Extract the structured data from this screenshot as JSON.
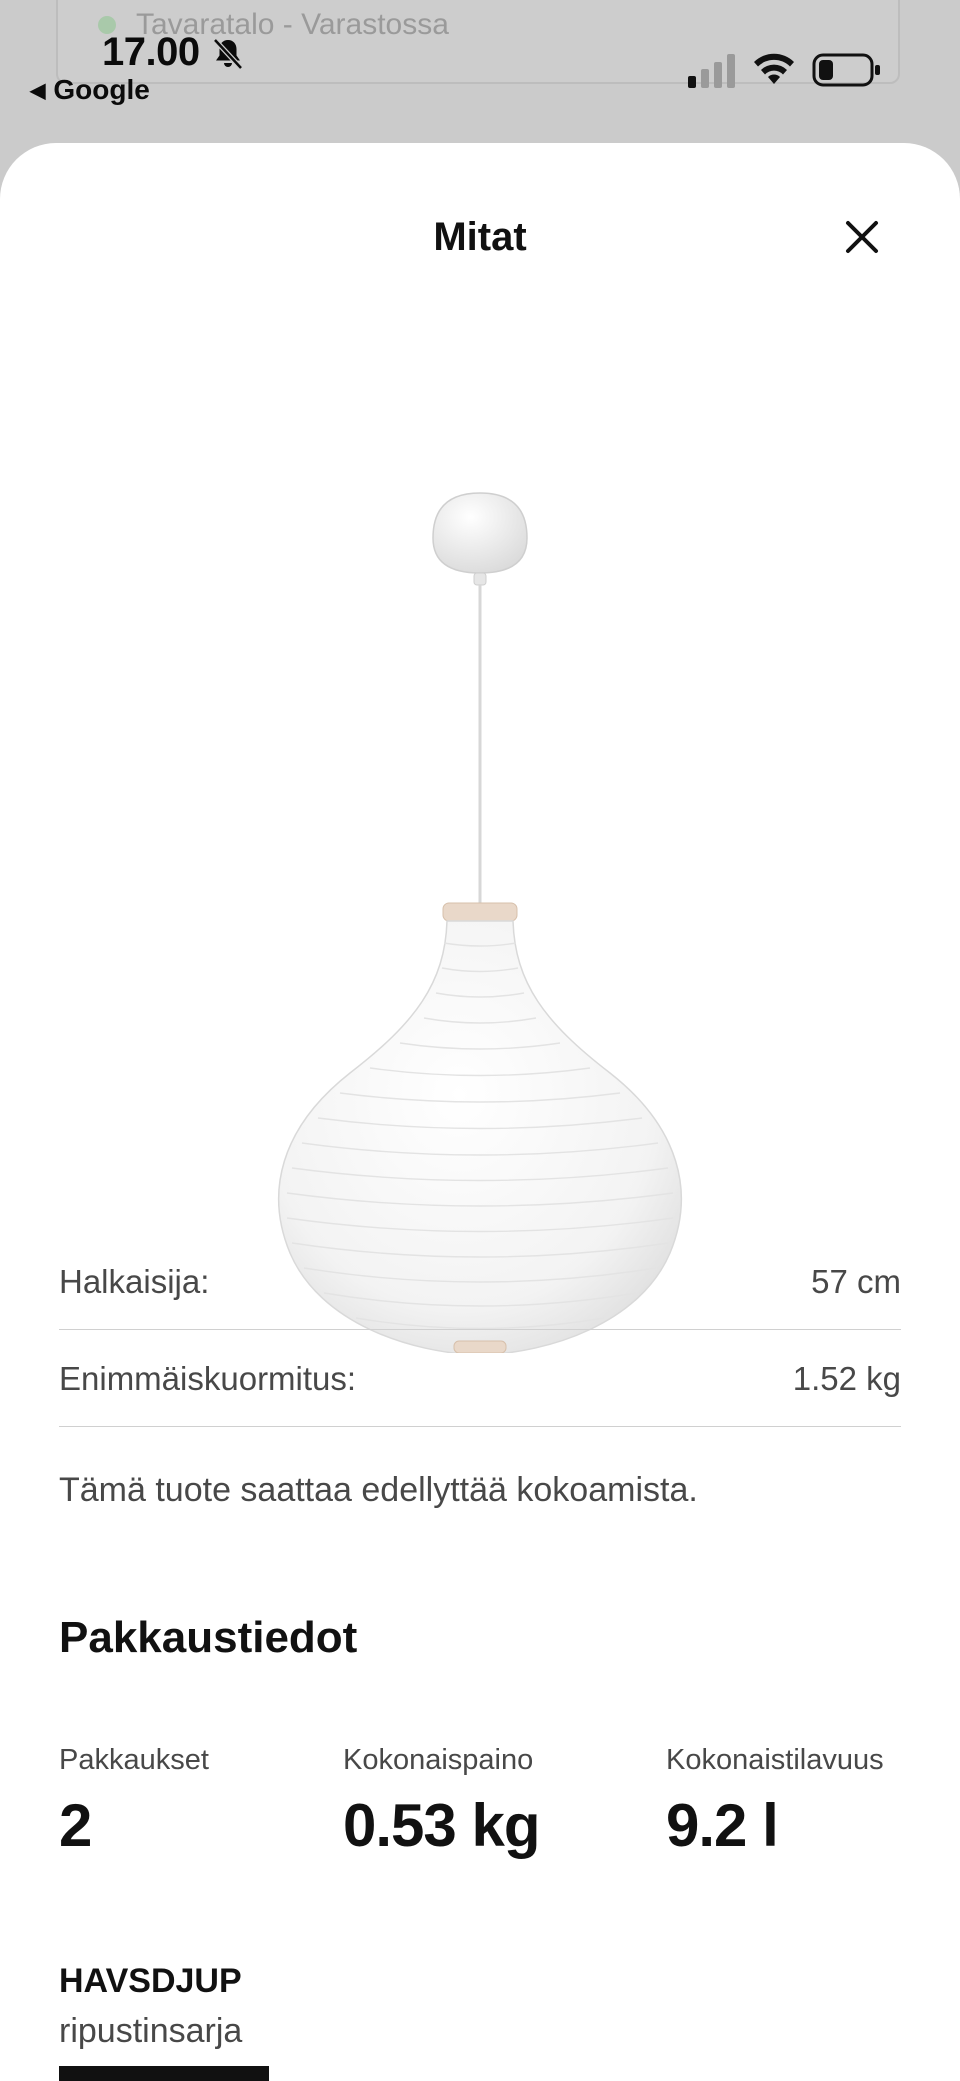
{
  "background_page": {
    "store_status": "Tavaratalo - Varastossa"
  },
  "status_bar": {
    "time": "17.00",
    "back_app": "Google",
    "silent_icon": "bell-slash-icon",
    "signal_icon": "cellular-signal-icon",
    "wifi_icon": "wifi-icon",
    "battery_icon": "battery-icon"
  },
  "sheet": {
    "title": "Mitat",
    "close_icon": "close-icon",
    "product_image": "paper-pendant-lamp-shade"
  },
  "dimensions": [
    {
      "label": "Halkaisija:",
      "value": "57 cm"
    },
    {
      "label": "Enimmäiskuormitus:",
      "value": "1.52 kg"
    }
  ],
  "assembly_note": "Tämä tuote saattaa edellyttää kokoamista.",
  "packaging": {
    "heading": "Pakkaustiedot",
    "columns": [
      {
        "label": "Pakkaukset",
        "value": "2"
      },
      {
        "label": "Kokonaispaino",
        "value": "0.53 kg"
      },
      {
        "label": "Kokonaistilavuus",
        "value": "9.2 l"
      }
    ]
  },
  "package_item": {
    "name": "HAVSDJUP",
    "description": "ripustinsarja"
  }
}
